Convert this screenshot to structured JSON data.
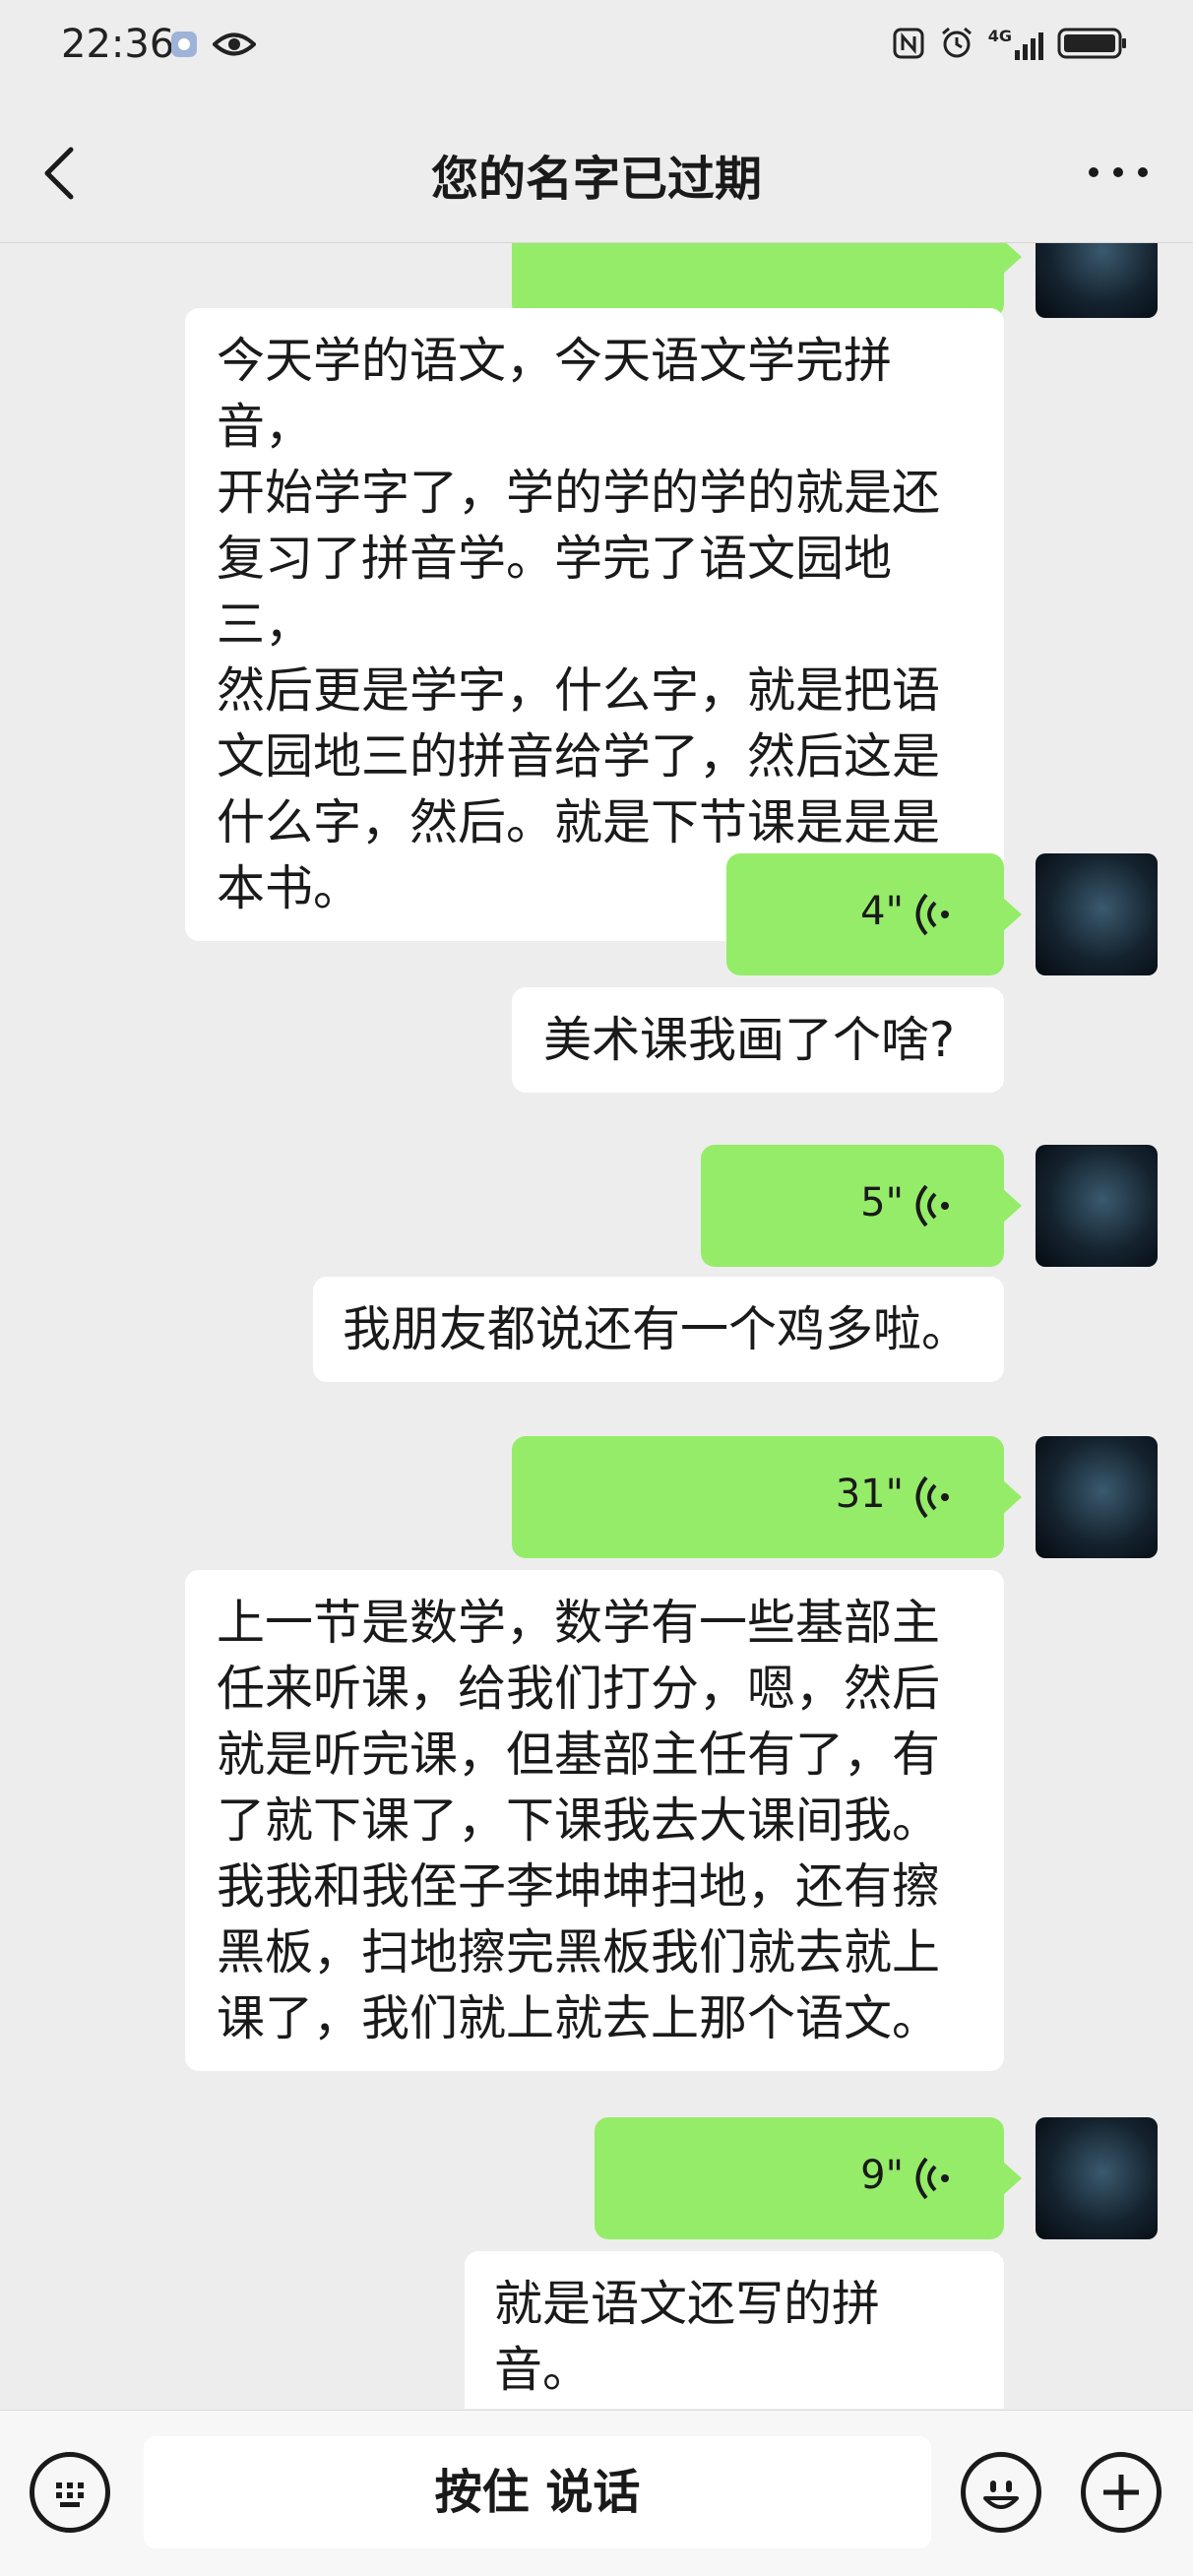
{
  "status_bar": {
    "time": "22:36",
    "left_icons": [
      "app-notification-icon",
      "eye-icon"
    ],
    "right_icons": [
      "nfc-icon",
      "alarm-icon",
      "signal-4g-icon",
      "battery-icon"
    ],
    "network_label": "4G"
  },
  "header": {
    "title": "您的名字已过期",
    "back_icon": "chevron-left-icon",
    "more_icon": "more-dots-icon"
  },
  "messages": [
    {
      "type": "voice",
      "sender": "me",
      "duration": "",
      "partial": true
    },
    {
      "type": "text",
      "sender": "me",
      "lines": [
        "今天学的语文，今天语文学完拼音，",
        "开始学字了，学的学的学的就是还",
        "复习了拼音学。学完了语文园地三，",
        "然后更是学字，什么字，就是把语",
        "文园地三的拼音给学了，然后这是",
        "什么字，然后。就是下节课是是是",
        "本书。"
      ]
    },
    {
      "type": "voice",
      "sender": "me",
      "duration": "4\""
    },
    {
      "type": "text",
      "sender": "me",
      "lines": [
        "美术课我画了个啥?"
      ]
    },
    {
      "type": "voice",
      "sender": "me",
      "duration": "5\""
    },
    {
      "type": "text",
      "sender": "me",
      "lines": [
        "我朋友都说还有一个鸡多啦。"
      ]
    },
    {
      "type": "voice",
      "sender": "me",
      "duration": "31\""
    },
    {
      "type": "text",
      "sender": "me",
      "lines": [
        "上一节是数学，数学有一些基部主",
        "任来听课，给我们打分，嗯，然后",
        "就是听完课，但基部主任有了，有",
        "了就下课了，下课我去大课间我。",
        "我我和我侄子李坤坤扫地，还有擦",
        "黑板，扫地擦完黑板我们就去就上",
        "课了，我们就上就去上那个语文。"
      ]
    },
    {
      "type": "voice",
      "sender": "me",
      "duration": "9\""
    },
    {
      "type": "text",
      "sender": "me",
      "lines": [
        "就是语文还写的拼音。"
      ]
    }
  ],
  "input_bar": {
    "keyboard_icon": "keyboard-icon",
    "talk_label": "按住 说话",
    "emoji_icon": "emoji-icon",
    "plus_icon": "plus-icon"
  },
  "colors": {
    "background": "#ededed",
    "voice_bubble": "#95ec69",
    "text_bubble": "#ffffff"
  }
}
